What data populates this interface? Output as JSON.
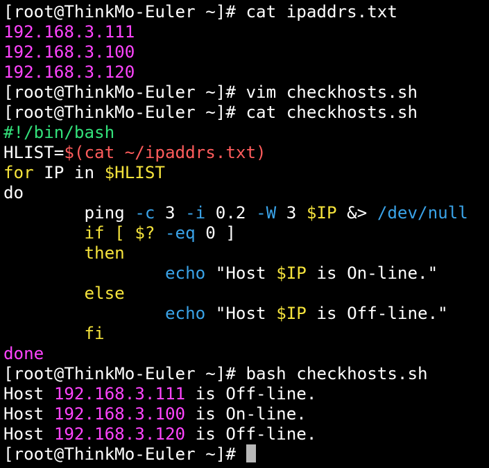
{
  "colors": {
    "background": "#000000",
    "text": "#ffffff",
    "magenta": "#ff44ff",
    "green": "#33e07a",
    "red": "#ff5c5c",
    "yellow": "#f5e33c",
    "blue": "#3aa3e8",
    "cursor": "#b8b8b8"
  },
  "prompt": "[root@ThinkMo-Euler ~]#",
  "commands": {
    "cat_ips": " cat ipaddrs.txt",
    "vim": " vim checkhosts.sh",
    "cat_script": " cat checkhosts.sh",
    "run": " bash checkhosts.sh"
  },
  "ip_list": [
    "192.168.3.111",
    "192.168.3.100",
    "192.168.3.120"
  ],
  "script": {
    "shebang": "#!/bin/bash",
    "hlist_var": "HLIST=",
    "hlist_value": "$(cat ~/ipaddrs.txt)",
    "for_kw": "for",
    "for_mid": " IP in ",
    "for_var": "$HLIST",
    "do_kw": "do",
    "ping_indent": "        ping ",
    "ping_opt_c": "-c",
    "ping_c_val": " 3 ",
    "ping_opt_i": "-i",
    "ping_i_val": " 0.2 ",
    "ping_opt_w": "-W",
    "ping_w_val": " 3 ",
    "ping_var": "$IP",
    "ping_redirect": " &> ",
    "ping_null": "/dev/null",
    "if_indent": "        ",
    "if_kw": "if [ ",
    "if_status": "$?",
    "if_op": " -eq",
    "if_tail": " 0 ]",
    "then_kw": "then",
    "echo_indent": "                ",
    "echo_kw": "echo",
    "echo_on_pre": " \"Host ",
    "echo_var": "$IP",
    "echo_on_post": " is On-line.\"",
    "else_kw": "else",
    "echo_off_pre": " \"Host ",
    "echo_off_post": " is Off-line.\"",
    "fi_kw": "fi",
    "done_kw": "done"
  },
  "results": [
    {
      "prefix": "Host ",
      "ip": "192.168.3.111",
      "status": " is Off-line."
    },
    {
      "prefix": "Host ",
      "ip": "192.168.3.100",
      "status": " is On-line."
    },
    {
      "prefix": "Host ",
      "ip": "192.168.3.120",
      "status": " is Off-line."
    }
  ]
}
